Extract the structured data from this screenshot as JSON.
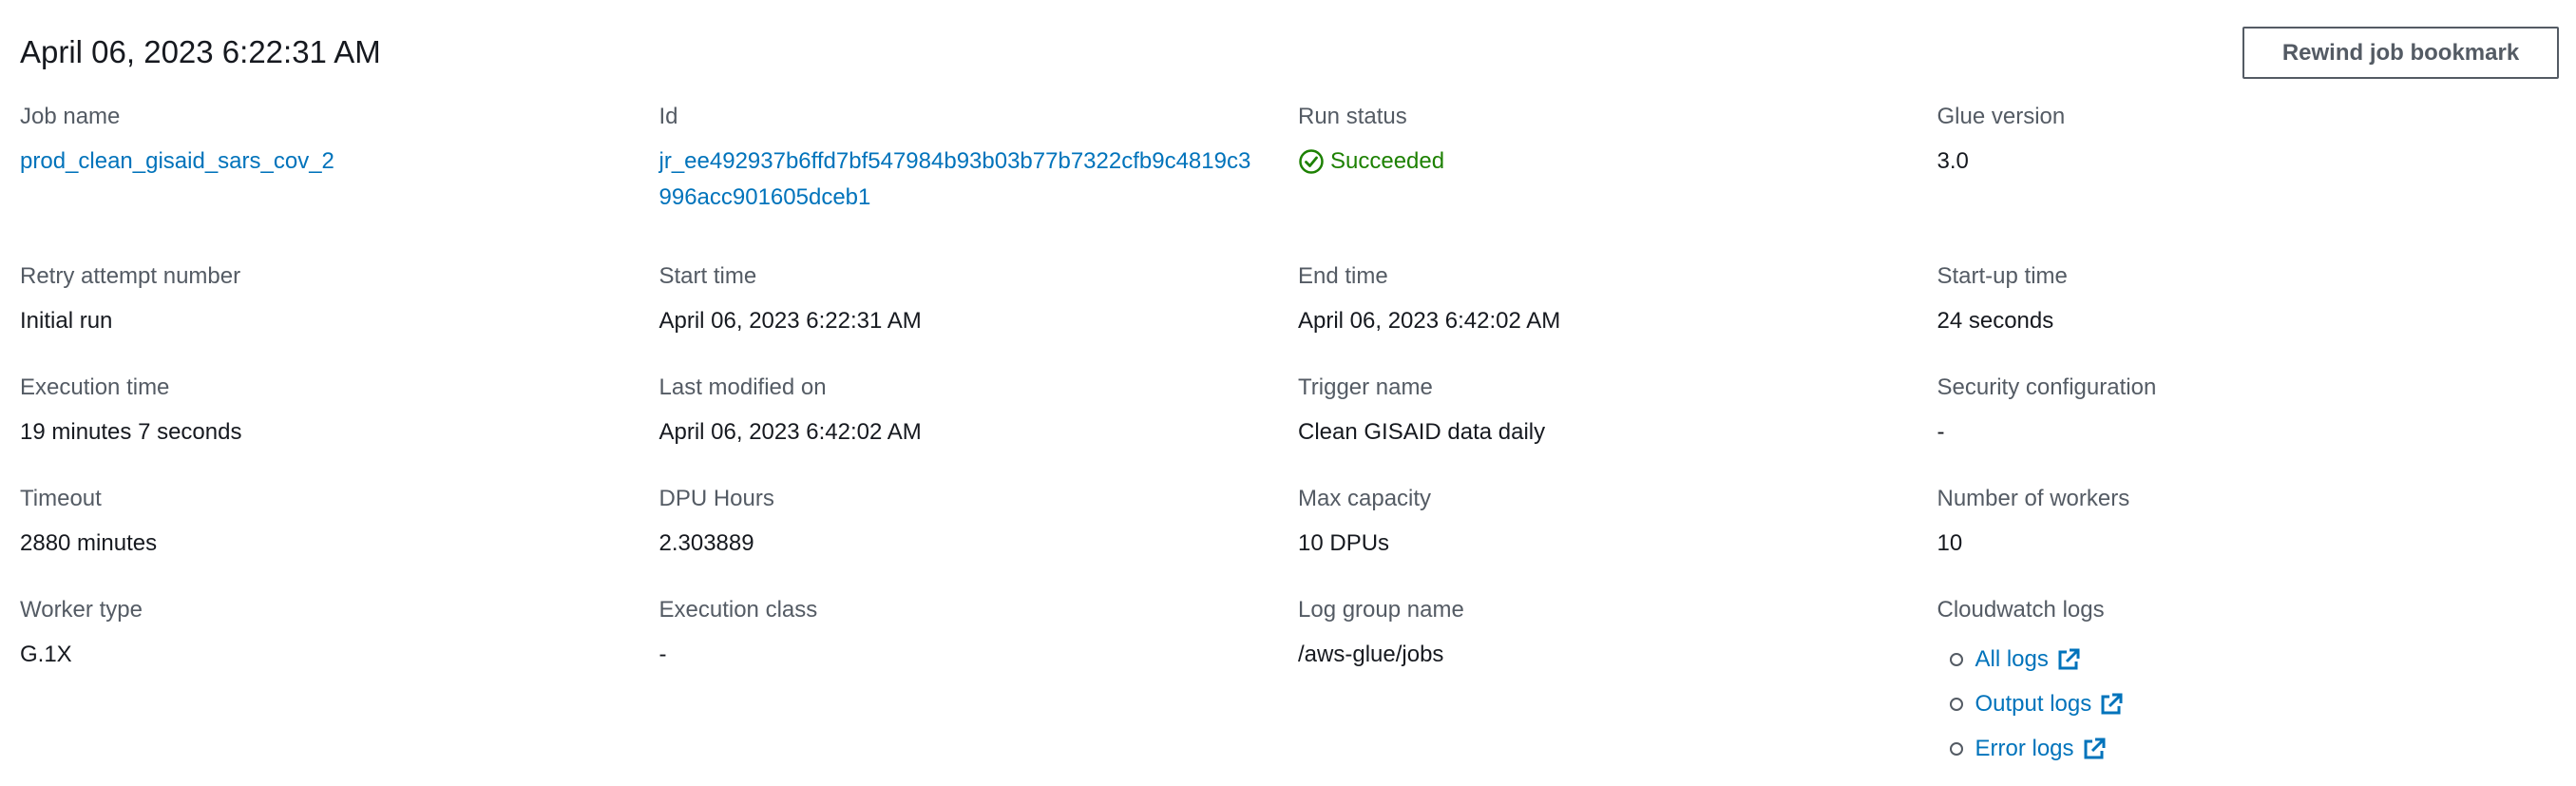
{
  "header": {
    "title": "April 06, 2023 6:22:31 AM",
    "rewind_button": "Rewind job bookmark"
  },
  "fields": {
    "job_name": {
      "label": "Job name",
      "value": "prod_clean_gisaid_sars_cov_2"
    },
    "id": {
      "label": "Id",
      "value": "jr_ee492937b6ffd7bf547984b93b03b77b7322cfb9c4819c3996acc901605dceb1"
    },
    "run_status": {
      "label": "Run status",
      "value": "Succeeded"
    },
    "glue_version": {
      "label": "Glue version",
      "value": "3.0"
    },
    "retry_attempt": {
      "label": "Retry attempt number",
      "value": "Initial run"
    },
    "start_time": {
      "label": "Start time",
      "value": "April 06, 2023 6:22:31 AM"
    },
    "end_time": {
      "label": "End time",
      "value": "April 06, 2023 6:42:02 AM"
    },
    "startup_time": {
      "label": "Start-up time",
      "value": "24 seconds"
    },
    "execution_time": {
      "label": "Execution time",
      "value": "19 minutes 7 seconds"
    },
    "last_modified": {
      "label": "Last modified on",
      "value": "April 06, 2023 6:42:02 AM"
    },
    "trigger_name": {
      "label": "Trigger name",
      "value": "Clean GISAID data daily"
    },
    "security_config": {
      "label": "Security configuration",
      "value": "-"
    },
    "timeout": {
      "label": "Timeout",
      "value": "2880 minutes"
    },
    "dpu_hours": {
      "label": "DPU Hours",
      "value": "2.303889"
    },
    "max_capacity": {
      "label": "Max capacity",
      "value": "10 DPUs"
    },
    "num_workers": {
      "label": "Number of workers",
      "value": "10"
    },
    "worker_type": {
      "label": "Worker type",
      "value": "G.1X"
    },
    "execution_class": {
      "label": "Execution class",
      "value": "-"
    },
    "log_group": {
      "label": "Log group name",
      "value": "/aws-glue/jobs"
    },
    "cloudwatch": {
      "label": "Cloudwatch logs",
      "links": [
        "All logs",
        "Output logs",
        "Error logs"
      ]
    }
  },
  "icons": {
    "status": "check-circle-icon",
    "external": "external-link-icon"
  },
  "colors": {
    "link": "#0073bb",
    "success": "#1d8102",
    "label": "#545b64",
    "text": "#16191f"
  }
}
